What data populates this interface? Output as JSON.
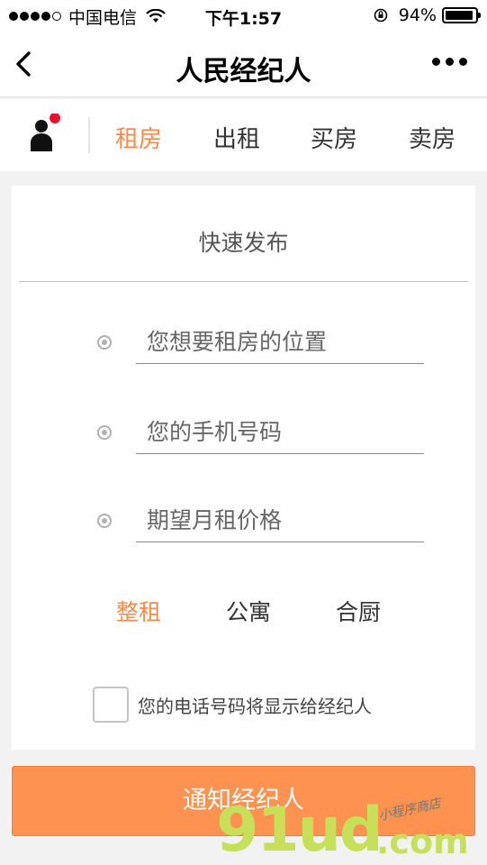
{
  "status_bar": {
    "carrier": "中国电信",
    "time": "下午1:57",
    "battery": "94%",
    "battery_level": 0.94
  },
  "nav": {
    "title": "人民经纪人",
    "back_icon": "chevron-left-icon",
    "more_icon": "more-dots-icon"
  },
  "tabs": [
    {
      "label": "租房",
      "active": true
    },
    {
      "label": "出租",
      "active": false
    },
    {
      "label": "买房",
      "active": false
    },
    {
      "label": "卖房",
      "active": false
    }
  ],
  "colors": {
    "accent": "#f58a4d",
    "button": "#fe9250",
    "notification": "#e8112d"
  },
  "form": {
    "title": "快速发布",
    "fields": [
      {
        "placeholder": "您想要租房的位置",
        "value": ""
      },
      {
        "placeholder": "您的手机号码",
        "value": ""
      },
      {
        "placeholder": "期望月租价格",
        "value": ""
      }
    ],
    "types": [
      {
        "label": "整租",
        "active": true
      },
      {
        "label": "公寓",
        "active": false
      },
      {
        "label": "合厨",
        "active": false
      }
    ],
    "checkbox_label": "您的电话号码将显示给经纪人",
    "checkbox_checked": false
  },
  "submit_label": "通知经纪人",
  "watermark": {
    "main": "91ud",
    "suffix": ".com",
    "tagline": "小程序商店"
  }
}
